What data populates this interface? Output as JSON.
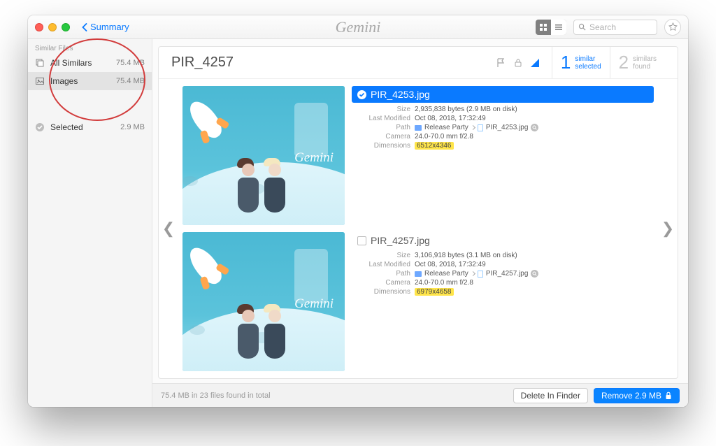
{
  "titlebar": {
    "back_label": "Summary",
    "brand": "Gemini",
    "search_placeholder": "Search"
  },
  "sidebar": {
    "header": "Similar Files",
    "items": [
      {
        "label": "All Similars",
        "size": "75.4 MB"
      },
      {
        "label": "Images",
        "size": "75.4 MB"
      }
    ],
    "selected": {
      "label": "Selected",
      "size": "2.9 MB"
    }
  },
  "card": {
    "title": "PIR_4257",
    "counter_selected": {
      "n": "1",
      "top": "similar",
      "bottom": "selected"
    },
    "counter_found": {
      "n": "2",
      "top": "similars",
      "bottom": "found"
    }
  },
  "files": [
    {
      "name": "PIR_4253.jpg",
      "checked": true,
      "size": "2,935,838 bytes (2.9 MB on disk)",
      "modified": "Oct 08, 2018, 17:32:49",
      "path_folder": "Release Party",
      "path_file": "PIR_4253.jpg",
      "camera": "24.0-70.0 mm f/2.8",
      "dimensions": "6512x4346"
    },
    {
      "name": "PIR_4257.jpg",
      "checked": false,
      "size": "3,106,918 bytes (3.1 MB on disk)",
      "modified": "Oct 08, 2018, 17:32:49",
      "path_folder": "Release Party",
      "path_file": "PIR_4257.jpg",
      "camera": "24.0-70.0 mm f/2.8",
      "dimensions": "6979x4658"
    }
  ],
  "labels": {
    "size": "Size",
    "modified": "Last Modified",
    "path": "Path",
    "camera": "Camera",
    "dimensions": "Dimensions"
  },
  "footer": {
    "status": "75.4 MB in 23 files found in total",
    "delete": "Delete In Finder",
    "remove": "Remove 2.9 MB"
  },
  "thumb_brand": "Gemini"
}
